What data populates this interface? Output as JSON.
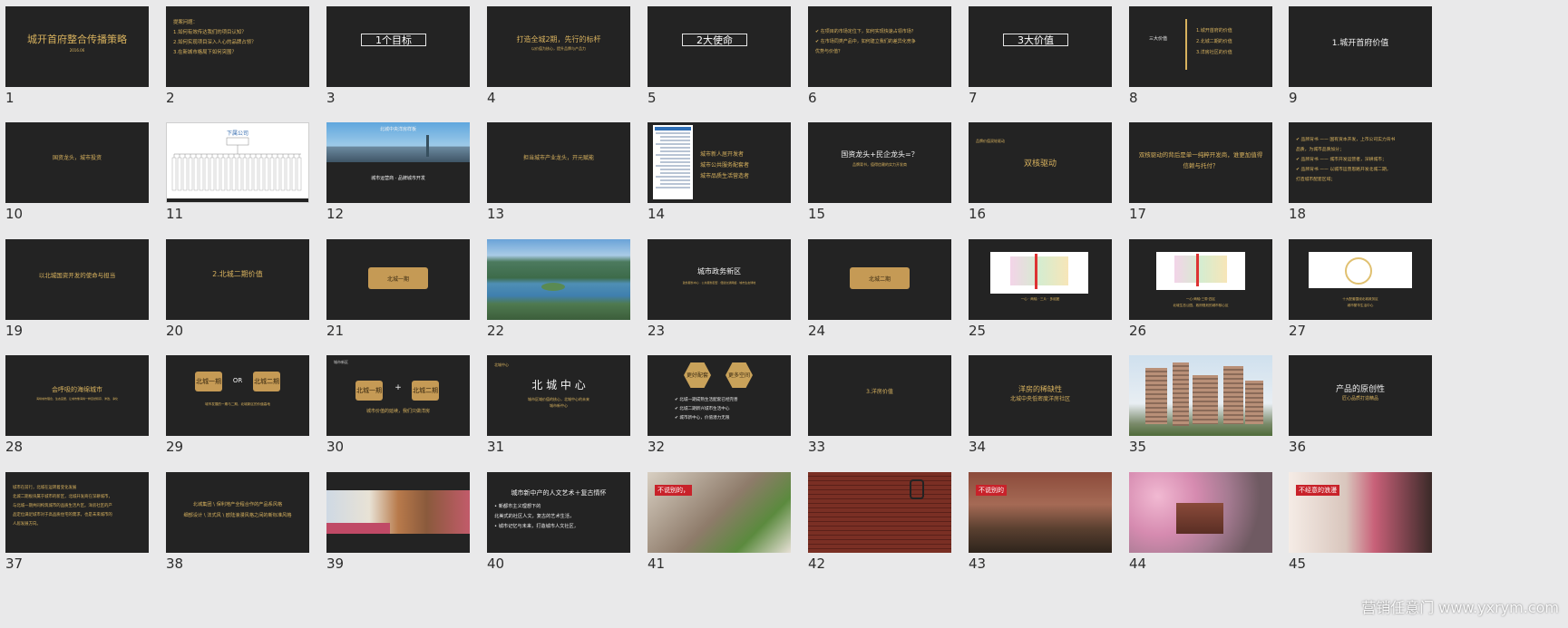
{
  "slides": [
    {
      "n": "1",
      "title": "城开首府整合传播策略",
      "sub": "2016.06"
    },
    {
      "n": "2",
      "lines": [
        "提案问题：",
        "1.如何有效传达我们的项目认知？",
        "2.如何实现项目深入人心的品牌占领？",
        "3.在新城市格局下如何突围？"
      ]
    },
    {
      "n": "3",
      "box": "1个目标"
    },
    {
      "n": "4",
      "title": "打造全城2期，先行的标杆",
      "sub": "以价值为核心，提升品牌与产品力"
    },
    {
      "n": "5",
      "box": "2大使命"
    },
    {
      "n": "6",
      "lines": [
        "✔ 在项目的市场定位下，如何实现快速占领市场？",
        "✔ 在市场同类产品中，如何建立我们的差异化竞争",
        "   优势与价值？"
      ]
    },
    {
      "n": "7",
      "box": "3大价值"
    },
    {
      "n": "8",
      "label": "三大价值",
      "lines": [
        "1.城开首府的价值",
        "2.北城二期的价值",
        "3.洋房社区的价值"
      ]
    },
    {
      "n": "9",
      "title": "1.城开首府价值"
    },
    {
      "n": "10",
      "title": "国资龙头，城市投资"
    },
    {
      "n": "11",
      "title": "下属公司"
    },
    {
      "n": "12",
      "banner": "北城中央洋房样板",
      "title": "城市运营商 · 品牌城市开发"
    },
    {
      "n": "13",
      "title": "担当城市产业龙头，开元赋能"
    },
    {
      "n": "14",
      "lines": [
        "城市新人居开发者",
        "城市公共服务配套者",
        "城市品质生活营造者"
      ]
    },
    {
      "n": "15",
      "title": "国资龙头+民企龙头=？",
      "sub": "品牌背书，值得信赖的实力开发商"
    },
    {
      "n": "16",
      "label": "品牌价值双轮驱动",
      "title": "双核驱动"
    },
    {
      "n": "17",
      "lines": [
        "双核驱动的背后是单一纯粹开发商，谁更加值得",
        "信赖与托付？"
      ]
    },
    {
      "n": "18",
      "lines": [
        "✔ 品牌背书 ——  国有资本开发，上市公司实力背书",
        "   品质，为城市品质加分；",
        "✔ 品牌背书 ——  城市开发运营者，深耕城市；",
        "✔ 品牌背书 ——  以城市运营思路开发北城二期，",
        "   打造城市配套区域；"
      ]
    },
    {
      "n": "19",
      "title": "以北城国资开发的使命与担当"
    },
    {
      "n": "20",
      "title": "2.北城二期价值"
    },
    {
      "n": "21",
      "pill": "北城一期"
    },
    {
      "n": "22"
    },
    {
      "n": "23",
      "title": "城市政务新区",
      "sub": "政务服务中心  ·  公共服务配套  ·  便捷交通网络  ·  城市生态绿地"
    },
    {
      "n": "24",
      "pill": "北城二期"
    },
    {
      "n": "25",
      "sub": "一心 · 两轴 · 三片 · 多组团"
    },
    {
      "n": "26",
      "sub": "一心·两轴·三带·四区",
      "sub2": "北城生态公园，政府规划的城市核心区"
    },
    {
      "n": "27",
      "sub": "十大配套围绕北城政务区",
      "sub2": "城市繁华生活中心"
    },
    {
      "n": "28",
      "title": "会呼吸的海绵城市",
      "sub": "海绵城市理念，生态宜居，让城市像海绵一样自然积存、渗透、净化"
    },
    {
      "n": "29",
      "pills": [
        "北城一期",
        "北城二期"
      ],
      "or": "OR",
      "sub": "城市发展的一期与二期，北城新区的价值高地"
    },
    {
      "n": "30",
      "label": "城市新区",
      "pills": [
        "北城一期",
        "北城二期"
      ],
      "plus": "+",
      "sub": "城市价值的延续，我们只做洋房"
    },
    {
      "n": "31",
      "label": "北城中心",
      "title": "北 城 中 心",
      "sub": "城市区域价值的核心，北城中心的未来",
      "sub2": "城市新中心"
    },
    {
      "n": "32",
      "hexes": [
        "更好配套",
        "更多空间"
      ],
      "lines": [
        "✔ 北城一期成熟生活配套已经完善",
        "✔ 北城二期新兴城市生活中心",
        "✔ 城市新中心，价值潜力无限"
      ]
    },
    {
      "n": "33",
      "title": "3.洋房价值"
    },
    {
      "n": "34",
      "title": "洋房的稀缺性",
      "sub": "北城中央低密度洋房社区"
    },
    {
      "n": "35"
    },
    {
      "n": "36",
      "title": "产品的原创性",
      "sub": "匠心品质打造精品"
    },
    {
      "n": "37",
      "lines": [
        "城市在前行，北城在运转着变化发展",
        "  北城二期板块属于城市的新区，北城开发商在深耕城市，",
        "  与北城一期共同构筑城市的品质生活片区。洋房社区的产",
        "  品定位满足城市对于高品质住宅的需求，也是未来城市的",
        "  人居发展方向。"
      ]
    },
    {
      "n": "38",
      "lines": [
        "北城集团 \\ 保利地产全程合作的产品系风格",
        "细部设计 \\ 法式风 \\ 欧陆浪漫风格之间的新标准风格"
      ]
    },
    {
      "n": "39"
    },
    {
      "n": "40",
      "title": "城市新中产的人文艺术＋复古情怀",
      "lines": [
        "• 新都市主义理想下的",
        "  北美式的社区人文，复古的艺术生活，",
        "• 城市记忆与未来，打造城市人文社区，"
      ]
    },
    {
      "n": "41",
      "tag": "不说别的，"
    },
    {
      "n": "42"
    },
    {
      "n": "43",
      "tag": "不说别的"
    },
    {
      "n": "44"
    },
    {
      "n": "45",
      "tag": "不经意的浪漫"
    }
  ],
  "watermark": "营销任意门  www.yxrym.com"
}
